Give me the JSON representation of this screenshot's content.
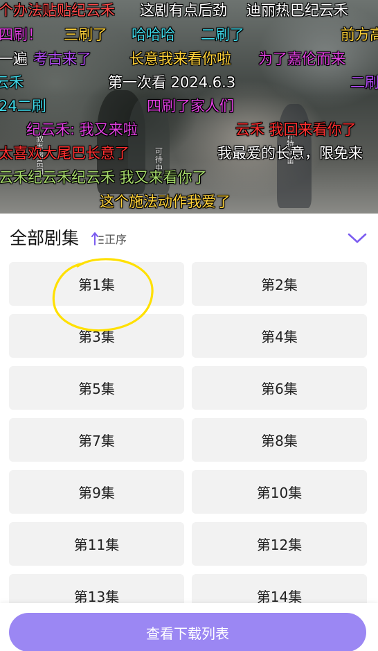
{
  "video": {
    "credits": [
      {
        "text": "叙事演员国"
      },
      {
        "text": "可待中"
      },
      {
        "text": "怀特演蕾"
      }
    ],
    "danmaku": [
      {
        "text": "个办法贴贴纪云禾",
        "color": "#ff4a4a"
      },
      {
        "text": "这剧有点后劲",
        "color": "#ffffff"
      },
      {
        "text": "迪丽热巴纪云禾",
        "color": "#ffffff"
      },
      {
        "text": "四刷！",
        "color": "#e040e0"
      },
      {
        "text": "三刷了",
        "color": "#ffd23a"
      },
      {
        "text": "哈哈哈",
        "color": "#3fd8e8"
      },
      {
        "text": "二刷了",
        "color": "#3fd8e8"
      },
      {
        "text": "前方高",
        "color": "#ffd23a"
      },
      {
        "text": "一遍",
        "color": "#ffffff"
      },
      {
        "text": "考古来了",
        "color": "#b04cf0"
      },
      {
        "text": "长意我来看你啦",
        "color": "#ffd23a"
      },
      {
        "text": "为了嘉伦而来",
        "color": "#e040e0"
      },
      {
        "text": "云禾",
        "color": "#3fd8e8"
      },
      {
        "text": "第一次看 2024.6.3",
        "color": "#ffffff"
      },
      {
        "text": "二刷",
        "color": "#b04cf0"
      },
      {
        "text": "24二刷",
        "color": "#3fd8e8"
      },
      {
        "text": "四刷了家人们",
        "color": "#e040e0"
      },
      {
        "text": "纪云禾: 我又来啦",
        "color": "#e040e0"
      },
      {
        "text": "云禾 我回来看你了",
        "color": "#ff3030"
      },
      {
        "text": "太喜欢大尾巴长意了",
        "color": "#ff3030"
      },
      {
        "text": "我最爱的长意，限免来",
        "color": "#ffffff"
      },
      {
        "text": "云禾纪云禾纪云禾 我又来看你了",
        "color": "#a5d86a"
      },
      {
        "text": "这个施法动作我爱了",
        "color": "#ffd23a"
      }
    ]
  },
  "panel": {
    "title": "全部剧集",
    "sort_label": "正序",
    "episodes": [
      {
        "label": "第1集"
      },
      {
        "label": "第2集"
      },
      {
        "label": "第3集"
      },
      {
        "label": "第4集"
      },
      {
        "label": "第5集"
      },
      {
        "label": "第6集"
      },
      {
        "label": "第7集"
      },
      {
        "label": "第8集"
      },
      {
        "label": "第9集"
      },
      {
        "label": "第10集"
      },
      {
        "label": "第11集"
      },
      {
        "label": "第12集"
      },
      {
        "label": "第13集"
      },
      {
        "label": "第14集"
      }
    ],
    "download_label": "查看下载列表"
  },
  "colors": {
    "accent": "#9b87f3",
    "highlight_annotation": "#ffe000",
    "episode_bg": "#f2f2f2"
  }
}
